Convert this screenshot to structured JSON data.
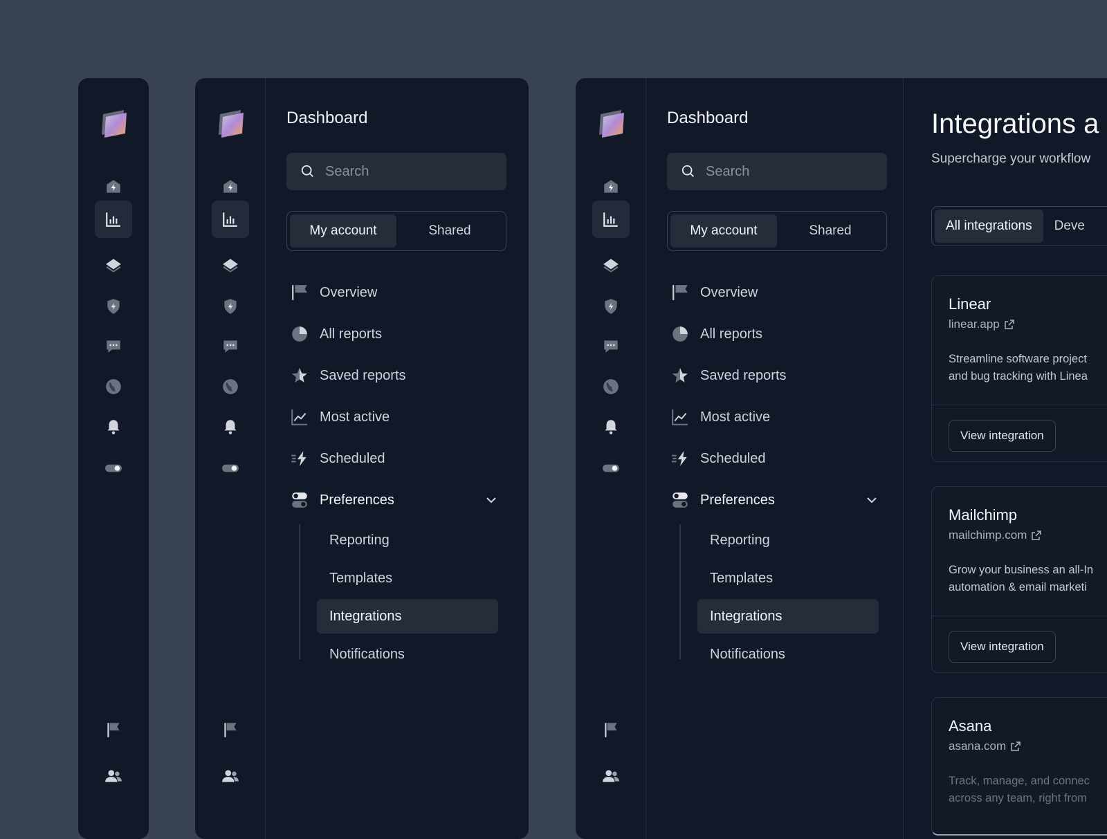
{
  "nav": {
    "title": "Dashboard",
    "search_placeholder": "Search",
    "segments": [
      "My account",
      "Shared"
    ],
    "items": [
      "Overview",
      "All reports",
      "Saved reports",
      "Most active",
      "Scheduled",
      "Preferences"
    ],
    "sub_items": [
      "Reporting",
      "Templates",
      "Integrations",
      "Notifications"
    ]
  },
  "rail": {
    "icons": [
      "home-bolt-icon",
      "bar-chart-icon",
      "layers-icon",
      "shield-bolt-icon",
      "chat-icon",
      "globe-icon",
      "bell-icon",
      "toggle-icon"
    ],
    "bottom_icons": [
      "flag-icon",
      "users-icon"
    ]
  },
  "integrations": {
    "title": "Integrations a",
    "subtitle": "Supercharge your workflow",
    "tabs": [
      "All integrations",
      "Deve"
    ],
    "cards": [
      {
        "name": "Linear",
        "url": "linear.app",
        "desc1": "Streamline software project",
        "desc2": "and bug tracking with Linea",
        "button": "View integration"
      },
      {
        "name": "Mailchimp",
        "url": "mailchimp.com",
        "desc1": "Grow your business an all-In",
        "desc2": "automation & email marketi",
        "button": "View integration"
      },
      {
        "name": "Asana",
        "url": "asana.com",
        "desc1": "Track, manage, and connec",
        "desc2": "across any team, right from",
        "button": ""
      }
    ]
  },
  "colors": {
    "background": "#3a4352",
    "panel": "#111827",
    "active": "#262d3a",
    "text": "#cfd3da"
  }
}
